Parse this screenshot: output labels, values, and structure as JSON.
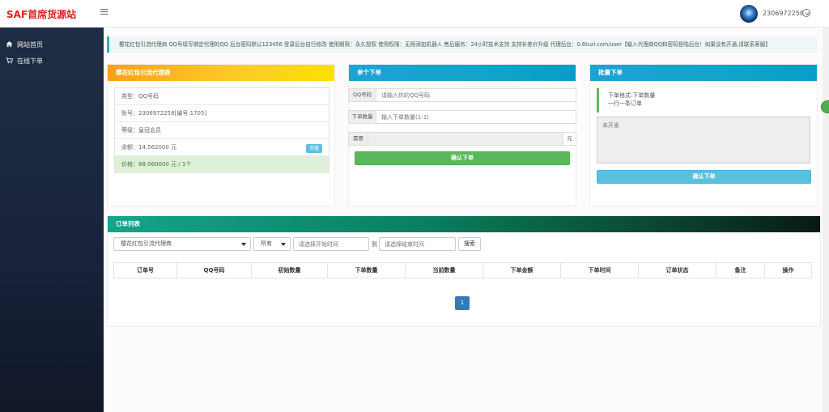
{
  "topbar": {
    "brand": "SAF首席货源站",
    "username": "2306972258"
  },
  "sidebar": {
    "items": [
      {
        "label": "网站首页",
        "icon": "home-icon"
      },
      {
        "label": "在线下单",
        "icon": "cart-icon"
      }
    ]
  },
  "notice": {
    "text": "樱花红包引流代理商 QQ号填写绑定代理的QQ 后台密码默认123456 登录后台自行修改 使用期限：永久授权 使用权限：无限添加机器人 售后服务：24小时技术支持 支持补差价升级 代理后台：0.6tuzi.com/user【输入代理商QQ和密码登陆后台！如果没有开通,请联系客服】"
  },
  "product_panel": {
    "title": "樱花红包引流代理商",
    "rows": [
      {
        "label": "类型：QQ号码"
      },
      {
        "label": "账号：2306972258[编号:1705]"
      },
      {
        "label": "等级：皇冠会员"
      },
      {
        "label": "余额：14.562000 元",
        "action": "充值"
      },
      {
        "label": "价格：68.060000 元 / 1个"
      }
    ],
    "header_color": "#fdb515"
  },
  "single_order": {
    "title": "单个下单",
    "qq_label": "QQ号码",
    "qq_placeholder": "请输入你的QQ号码",
    "qty_label": "下单数量",
    "qty_placeholder": "输入下单数量(1-1)",
    "cost_label": "需要",
    "cost_unit": "元",
    "submit": "确认下单"
  },
  "bulk_order": {
    "title": "批量下单",
    "tip_line1": "下单格式:下单数量",
    "tip_line2": "一行一条订单",
    "textarea_placeholder": "未开发",
    "submit": "确认下单"
  },
  "orders": {
    "title": "订单列表",
    "product_select": "樱花红包引流代理商",
    "status_select": "所有",
    "start_placeholder": "请选择开始时间",
    "to_label": "到",
    "end_placeholder": "请选择结束时间",
    "search_button": "搜索",
    "columns": [
      "订单号",
      "QQ号码",
      "初始数量",
      "下单数量",
      "当前数量",
      "下单金额",
      "下单时间",
      "订单状态",
      "备注",
      "操作"
    ],
    "page": "1"
  }
}
